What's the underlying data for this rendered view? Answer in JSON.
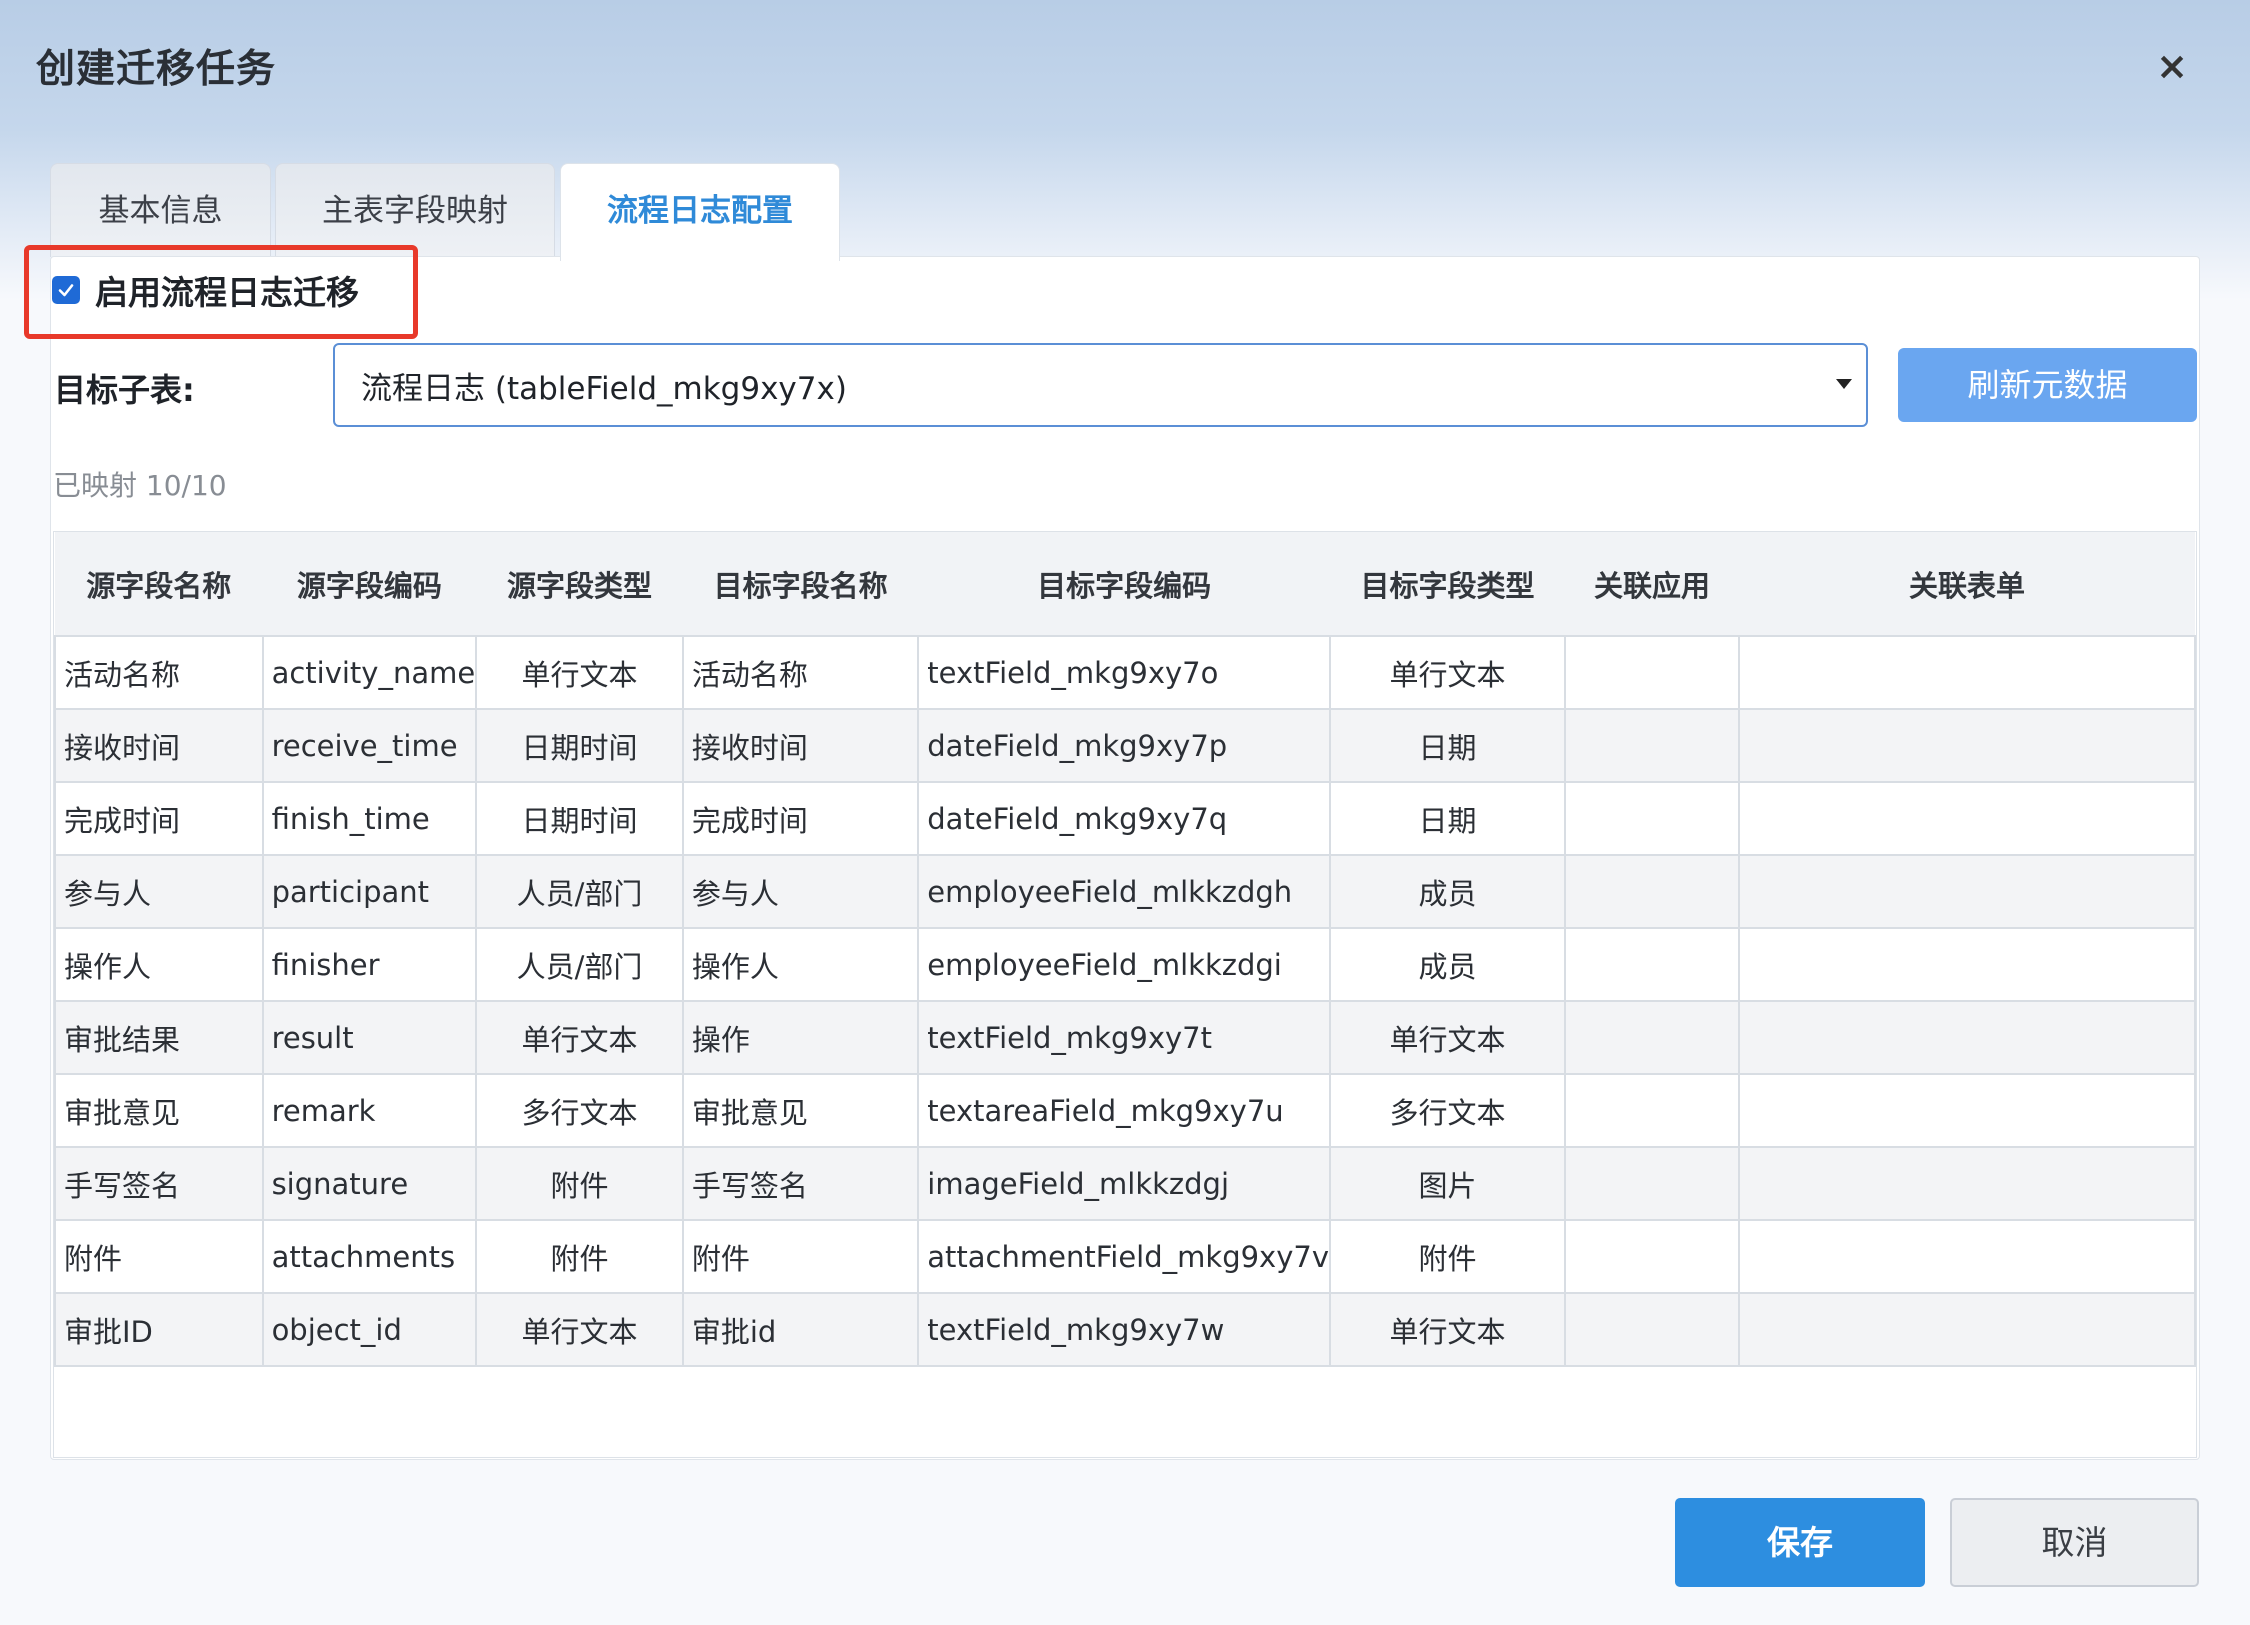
{
  "dialog": {
    "title": "创建迁移任务",
    "close_glyph": "×"
  },
  "tabs": [
    {
      "label": "基本信息",
      "active": false
    },
    {
      "label": "主表字段映射",
      "active": false
    },
    {
      "label": "流程日志配置",
      "active": true
    }
  ],
  "enable_migration": {
    "label": "启用流程日志迁移",
    "checked": true
  },
  "target_subtable": {
    "label": "目标子表:",
    "value": "流程日志 (tableField_mkg9xy7x)"
  },
  "refresh_button": "刷新元数据",
  "mapped_status": "已映射 10/10",
  "table": {
    "headers": [
      "源字段名称",
      "源字段编码",
      "源字段类型",
      "目标字段名称",
      "目标字段编码",
      "目标字段类型",
      "关联应用",
      "关联表单"
    ],
    "rows": [
      [
        "活动名称",
        "activity_name",
        "单行文本",
        "活动名称",
        "textField_mkg9xy7o",
        "单行文本",
        "",
        ""
      ],
      [
        "接收时间",
        "receive_time",
        "日期时间",
        "接收时间",
        "dateField_mkg9xy7p",
        "日期",
        "",
        ""
      ],
      [
        "完成时间",
        "finish_time",
        "日期时间",
        "完成时间",
        "dateField_mkg9xy7q",
        "日期",
        "",
        ""
      ],
      [
        "参与人",
        "participant",
        "人员/部门",
        "参与人",
        "employeeField_mlkkzdgh",
        "成员",
        "",
        ""
      ],
      [
        "操作人",
        "finisher",
        "人员/部门",
        "操作人",
        "employeeField_mlkkzdgi",
        "成员",
        "",
        ""
      ],
      [
        "审批结果",
        "result",
        "单行文本",
        "操作",
        "textField_mkg9xy7t",
        "单行文本",
        "",
        ""
      ],
      [
        "审批意见",
        "remark",
        "多行文本",
        "审批意见",
        "textareaField_mkg9xy7u",
        "多行文本",
        "",
        ""
      ],
      [
        "手写签名",
        "signature",
        "附件",
        "手写签名",
        "imageField_mlkkzdgj",
        "图片",
        "",
        ""
      ],
      [
        "附件",
        "attachments",
        "附件",
        "附件",
        "attachmentField_mkg9xy7v",
        "附件",
        "",
        ""
      ],
      [
        "审批ID",
        "object_id",
        "单行文本",
        "审批id",
        "textField_mkg9xy7w",
        "单行文本",
        "",
        ""
      ]
    ]
  },
  "footer": {
    "save_label": "保存",
    "cancel_label": "取消"
  },
  "colors": {
    "accent": "#2d8ee0",
    "highlight_border": "#e8392a",
    "refresh_button_bg": "#6aa6f0",
    "checkbox": "#1f6ad6"
  },
  "icons": {
    "close": "close-icon",
    "checkbox": "checkmark-icon",
    "dropdown": "caret-down-icon"
  }
}
